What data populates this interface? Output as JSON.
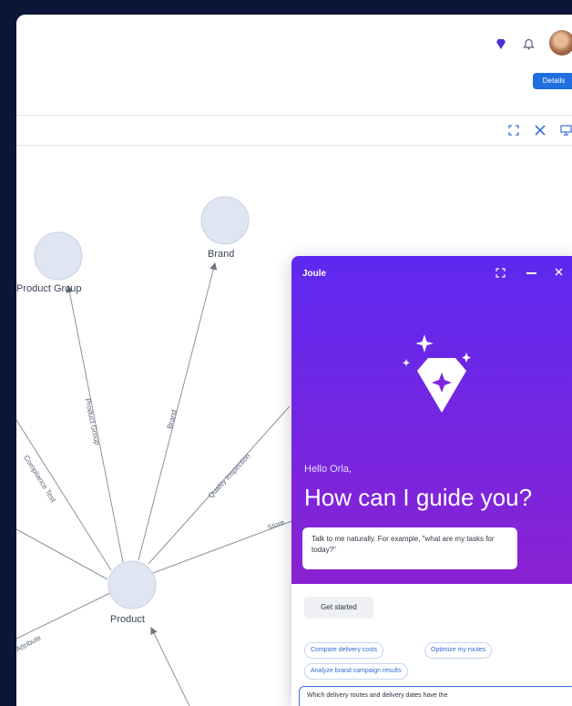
{
  "header": {
    "details_label": "Details"
  },
  "graph": {
    "nodes": {
      "product_group": "Product Group",
      "brand": "Brand",
      "product": "Product"
    },
    "edges": {
      "product_group": "Product Group",
      "brand": "Brand",
      "compliance": "Compliance Test",
      "quality": "Quality Inspection",
      "store": "Store",
      "bottom_left": "Attribute"
    }
  },
  "joule": {
    "title": "Joule",
    "greeting": "Hello Orla,",
    "headline": "How can I guide you?",
    "hint": "Talk to me naturally. For example, \"what are my tasks for today?\"",
    "get_started": "Get started",
    "suggestions": [
      "Compare delivery costs",
      "Optimize my routes",
      "Analyze brand campaign results"
    ],
    "input_text": "Which delivery routes and delivery dates have the"
  },
  "colors": {
    "page_bg": "#0b1535",
    "accent_blue": "#1f6fe0",
    "joule_gradient_top": "#5e28f0",
    "joule_gradient_bottom": "#8a22d2",
    "node_fill": "#dfe5f1"
  },
  "icons": [
    "diamond-icon",
    "bell-icon",
    "avatar",
    "expand-icon",
    "close-icon",
    "monitor-icon",
    "pan-control",
    "zoom-in-icon",
    "zoom-out-icon",
    "joule-diamond-logo"
  ]
}
